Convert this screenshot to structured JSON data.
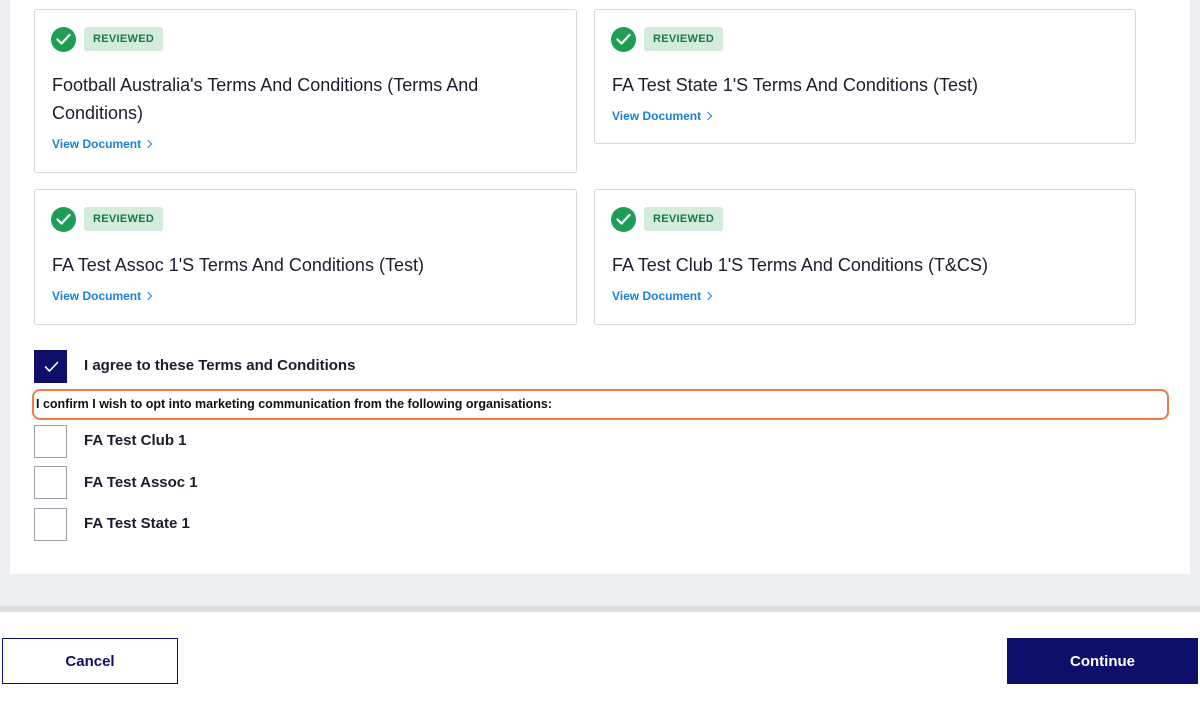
{
  "documents": [
    {
      "status": "REVIEWED",
      "title": "Football Australia's Terms And Conditions (Terms And Conditions)",
      "link": "View Document"
    },
    {
      "status": "REVIEWED",
      "title": "FA Test State 1'S Terms And Conditions (Test)",
      "link": "View Document"
    },
    {
      "status": "REVIEWED",
      "title": "FA Test Assoc 1'S Terms And Conditions (Test)",
      "link": "View Document"
    },
    {
      "status": "REVIEWED",
      "title": "FA Test Club 1'S Terms And Conditions (T&CS)",
      "link": "View Document"
    }
  ],
  "agree": {
    "label": "I agree to these Terms and Conditions",
    "checked": true
  },
  "marketing": {
    "prompt": "I confirm I wish to opt into marketing communication from the following organisations:",
    "options": [
      {
        "label": "FA Test Club 1",
        "checked": false
      },
      {
        "label": "FA Test Assoc 1",
        "checked": false
      },
      {
        "label": "FA Test State 1",
        "checked": false
      }
    ]
  },
  "footer": {
    "cancel": "Cancel",
    "continue": "Continue"
  },
  "colors": {
    "primary": "#0d0f6b",
    "success": "#1f9d55",
    "link": "#1b7fd6",
    "highlight": "#ef7b45"
  }
}
